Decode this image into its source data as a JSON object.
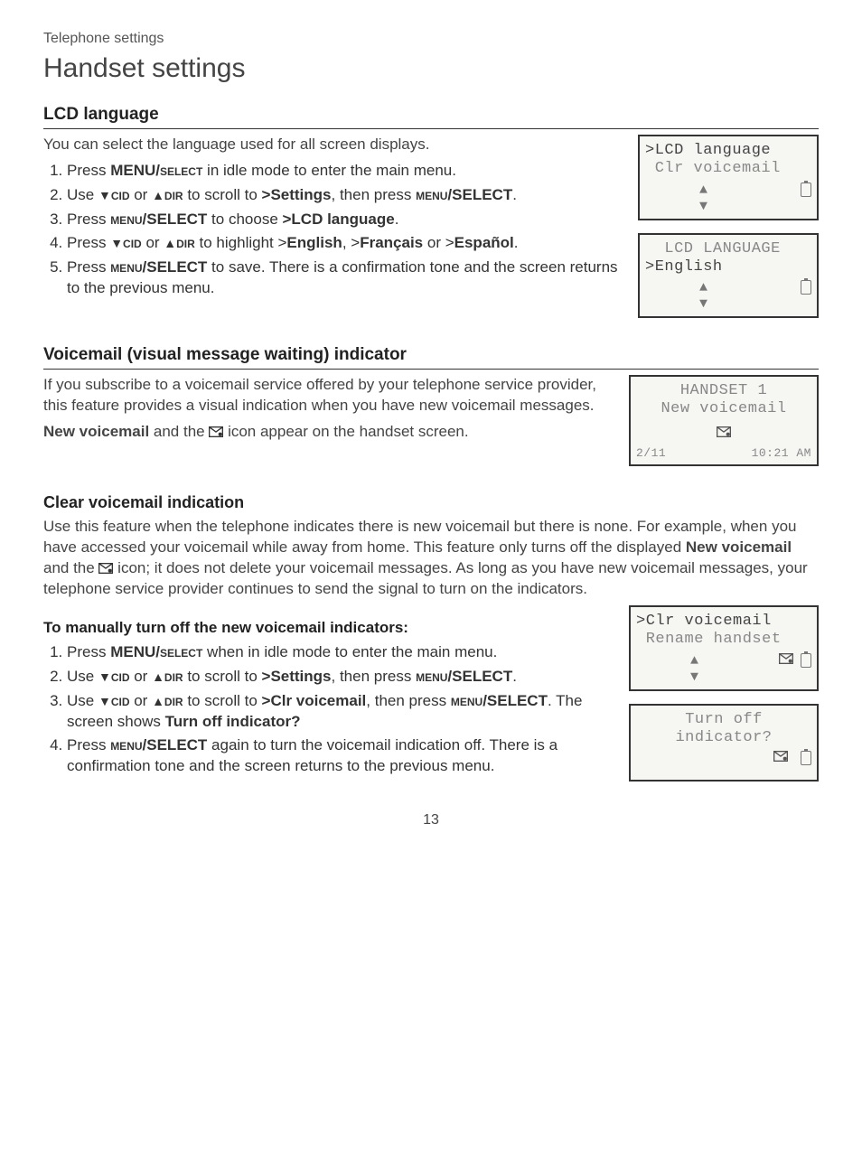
{
  "header": {
    "kicker": "Telephone settings",
    "title": "Handset settings"
  },
  "lcd_language": {
    "heading": "LCD language",
    "intro": "You can select the language used for all screen displays.",
    "step1_pre": "Press ",
    "step1_menu": "MENU/",
    "step1_select": "select",
    "step1_post": " in idle mode to enter the main menu.",
    "step2_pre": "Use ",
    "step2_cid": "cid",
    "step2_or": " or ",
    "step2_dir": "dir",
    "step2_scroll": " to scroll to ",
    "step2_target": ">Settings",
    "step2_then": ", then press ",
    "step2_menu": "menu",
    "step2_select": "/SELECT",
    "step2_period": ".",
    "step3_pre": "Press ",
    "step3_menu": "menu",
    "step3_select": "/SELECT",
    "step3_choose": " to choose ",
    "step3_target": ">LCD language",
    "step3_period": ".",
    "step4_pre": "Press ",
    "step4_cid": "cid",
    "step4_or": " or ",
    "step4_dir": "dir",
    "step4_high": " to highlight >",
    "step4_en": "English",
    "step4_c2": ", >",
    "step4_fr": "Français",
    "step4_or2": " or >",
    "step4_es": "Español",
    "step4_period": ".",
    "step5_pre": "Press ",
    "step5_menu": "menu",
    "step5_select": "/SELECT",
    "step5_post": " to save. There is a confirmation tone and the screen returns to the previous menu."
  },
  "voicemail_ind": {
    "heading": "Voicemail (visual message waiting) indicator",
    "intro": "If you subscribe to a voicemail service offered by your telephone service provider, this feature provides a visual indication when you have new voicemail messages.",
    "line2_bold": "New voicemail",
    "line2_mid": " and the ",
    "line2_post": " icon appear on the handset screen."
  },
  "clear_vm": {
    "heading": "Clear voicemail indication",
    "p1_pre": "Use this feature when the telephone indicates there is new voicemail but there is none. For example, when you have accessed your voicemail while away from home. This feature only turns off the displayed ",
    "p1_b1": "New voicemail",
    "p1_mid": " and the ",
    "p1_post": " icon; it does not delete your voicemail messages. As long as you have new voicemail messages, your telephone service provider continues to send the signal to turn on the indicators.",
    "sub": "To manually turn off the new voicemail indicators:",
    "s1_pre": "Press ",
    "s1_menu": "MENU/",
    "s1_select": "select",
    "s1_post": " when in idle mode to enter the main menu.",
    "s2_pre": "Use ",
    "s2_cid": "cid",
    "s2_or": " or ",
    "s2_dir": "dir",
    "s2_scroll": " to scroll to ",
    "s2_target": ">Settings",
    "s2_then": ", then press ",
    "s2_menu": "menu",
    "s2_select": "/SELECT",
    "s2_period": ".",
    "s3_pre": "Use ",
    "s3_cid": "cid",
    "s3_or": " or ",
    "s3_dir": "dir",
    "s3_scroll": " to scroll to ",
    "s3_target": ">Clr voicemail",
    "s3_then": ", then press ",
    "s3_menu": "menu",
    "s3_select": "/SELECT",
    "s3_shows": ". The screen shows ",
    "s3_turn": "Turn off indicator?",
    "s4_pre": "Press ",
    "s4_menu": "menu",
    "s4_select": "/SELECT",
    "s4_post": " again to turn the voicemail indication off. There is a confirmation tone and the screen returns to the previous menu."
  },
  "screens": {
    "s1_l1": ">LCD language",
    "s1_l2": " Clr voicemail",
    "s2_l1": "  LCD LANGUAGE",
    "s2_l2": ">English",
    "s3_l1": "HANDSET 1",
    "s3_l2": "New voicemail",
    "s3_date": "2/11",
    "s3_time": "10:21 AM",
    "s4_l1": ">Clr voicemail",
    "s4_l2": " Rename handset",
    "s5_l1": "Turn off",
    "s5_l2": "indicator?"
  },
  "pagenum": "13"
}
